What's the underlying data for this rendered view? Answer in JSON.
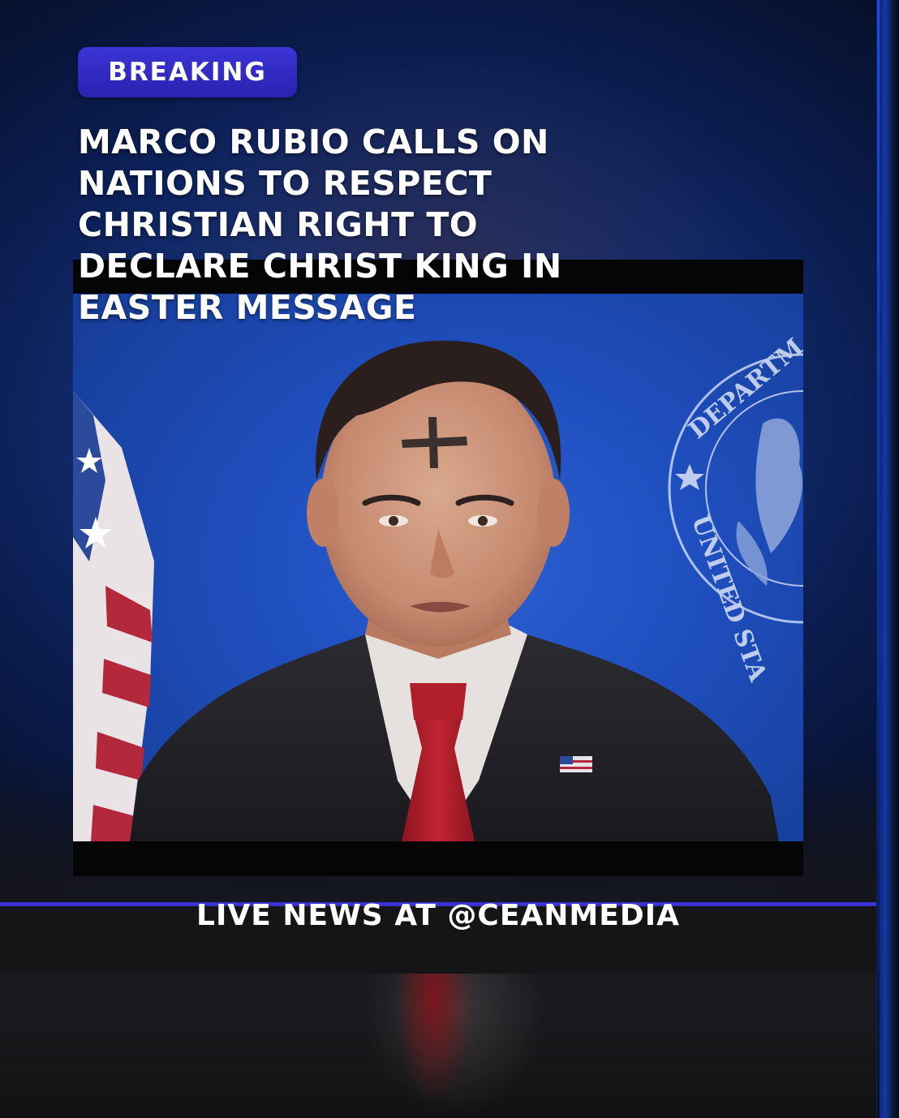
{
  "badge": {
    "label": "BREAKING"
  },
  "headline": {
    "lines": [
      "MARCO RUBIO CALLS ON",
      "NATIONS TO RESPECT",
      "CHRISTIAN RIGHT TO",
      "DECLARE CHRIST KING IN",
      "EASTER MESSAGE"
    ]
  },
  "seal": {
    "text_top": "DEPARTM",
    "text_bottom": "UNITED STA"
  },
  "ticker": {
    "label": "LIVE NEWS AT @CEANMEDIA"
  },
  "colors": {
    "accent": "#3a33d4",
    "background": "#0b1d4f",
    "photo_backdrop": "#1f4fbf",
    "tie": "#b01e2a"
  },
  "icons": [
    "flag-icon",
    "seal-icon",
    "ash-cross-icon",
    "lapel-flag-pin-icon"
  ]
}
